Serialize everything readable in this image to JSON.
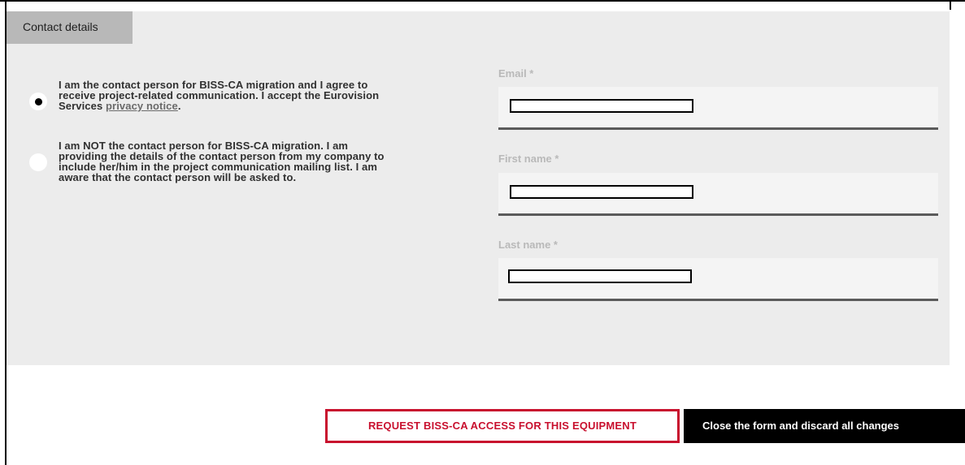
{
  "tab": {
    "label": "Contact details"
  },
  "radios": [
    {
      "selected": true,
      "lines": [
        "I am the contact person for BISS-CA migration and I agree to",
        "receive project-related communication. I accept the Eurovision"
      ],
      "last_line_prefix": "Services ",
      "link_text": "privacy notice",
      "last_line_suffix": "."
    },
    {
      "selected": false,
      "lines": [
        "I am NOT the contact person for BISS-CA migration. I am",
        "providing the details of the contact person from my company to",
        "include her/him in the project communication mailing list. I am",
        "aware that the contact person will be asked to."
      ]
    }
  ],
  "fields": {
    "email": {
      "label": "Email *"
    },
    "first_name": {
      "label": "First name *"
    },
    "last_name": {
      "label": "Last name *"
    }
  },
  "buttons": {
    "request": "REQUEST BISS-CA ACCESS FOR THIS EQUIPMENT",
    "close": "Close the form and discard all changes"
  }
}
